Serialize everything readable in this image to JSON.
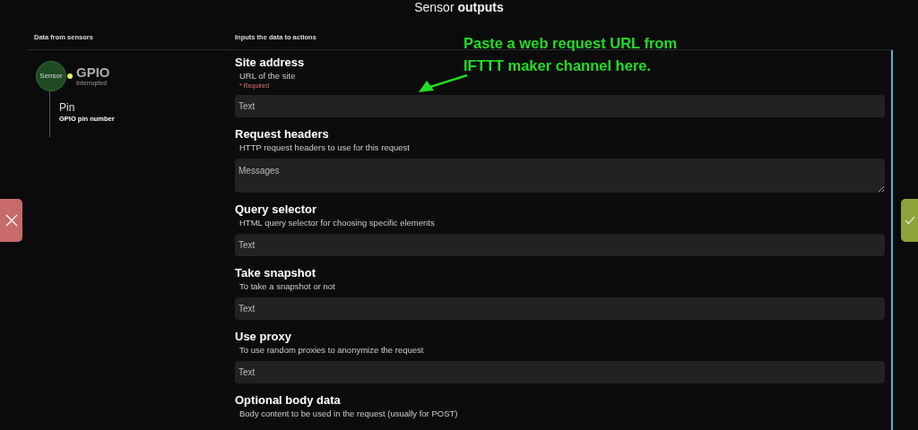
{
  "modal": {
    "title": "Sensor **outputs**"
  },
  "left_column": {
    "heading": "Data from sensors",
    "sensor": {
      "badge": "Sensor",
      "name": "GPIO",
      "status": "Interrupted",
      "outputs": [
        {
          "name": "Pin",
          "description": "GPIO pin number"
        }
      ]
    }
  },
  "right_column": {
    "heading": "Inputs the data to actions",
    "fields": [
      {
        "label": "Site address",
        "description": "URL of the site",
        "required_note": "* Required",
        "kind": "input",
        "placeholder": "Text"
      },
      {
        "label": "Request headers",
        "description": "HTTP request headers to use for this request",
        "kind": "textarea",
        "placeholder": "Messages"
      },
      {
        "label": "Query selector",
        "description": "HTML query selector for choosing specific elements",
        "kind": "input",
        "placeholder": "Text"
      },
      {
        "label": "Take snapshot",
        "description": "To take a snapshot or not",
        "kind": "input",
        "placeholder": "Text"
      },
      {
        "label": "Use proxy",
        "description": "To use random proxies to anonymize the request",
        "kind": "input",
        "placeholder": "Text"
      },
      {
        "label": "Optional body data",
        "description": "Body content to be used in the request (usually for POST)"
      }
    ]
  },
  "annotation": {
    "text": "Paste a web request URL from IFTTT maker channel here."
  }
}
